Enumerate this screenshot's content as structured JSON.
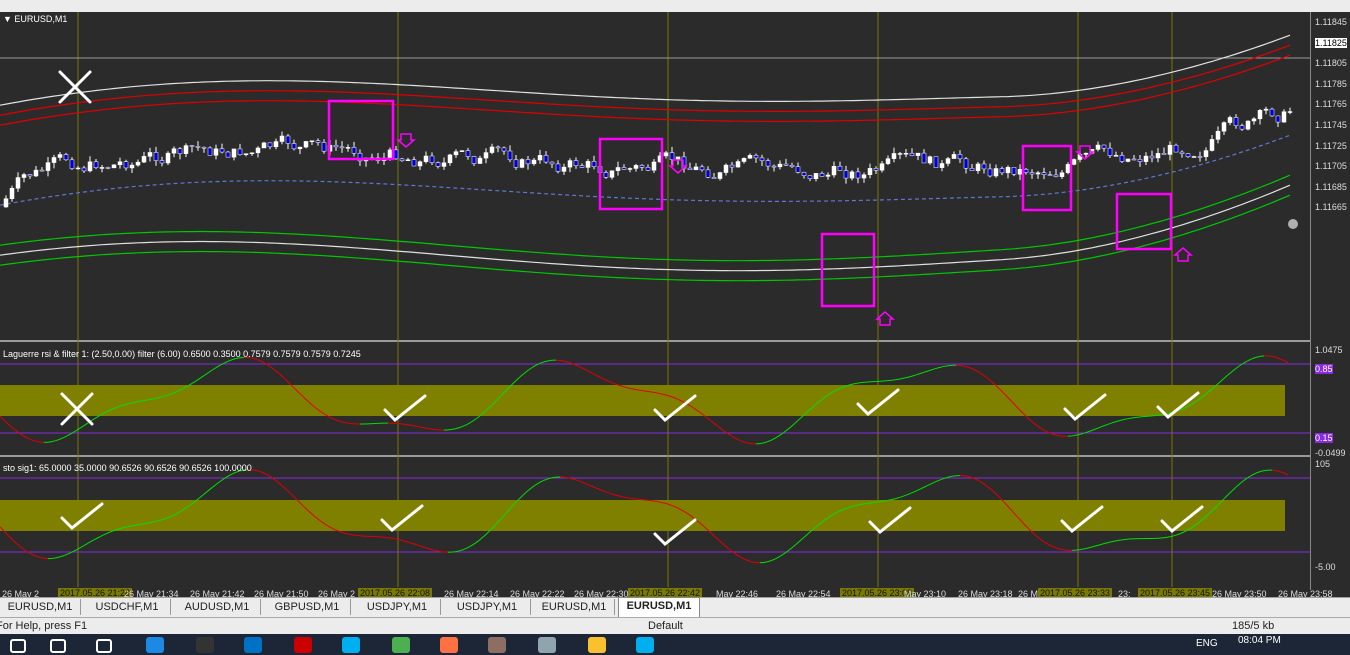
{
  "symbol_title": "EURUSD,M1",
  "price_axis": [
    "1.11845",
    "1.11825",
    "1.11805",
    "1.11785",
    "1.11765",
    "1.11745",
    "1.11725",
    "1.11705",
    "1.11685",
    "1.11665"
  ],
  "current_price": "1.11825",
  "laguerre": {
    "label": "Laguerre rsi & filter 1: (2.50,0.00) filter (6.00) 0.6500 0.3500 0.7579 0.7579 0.7579 0.7245",
    "axis": [
      "1.0475",
      "0.85",
      "0.15",
      "-0.0499"
    ]
  },
  "stochastic": {
    "label": "sto sig1: 65.0000 35.0000 90.6526 90.6526 90.6526 100.0000",
    "axis": [
      "105",
      "-5.00"
    ]
  },
  "time_axis": {
    "labels": [
      "26 May 2",
      "26 May 21:34",
      "26 May 21:42",
      "26 May 21:50",
      "26 May 2",
      "26 May 22:14",
      "26 May 22:22",
      "26 May 22:30",
      "May 22:46",
      "26 May 22:54",
      "May 23:10",
      "26 May 23:18",
      "26 M",
      "23:",
      "26 May 23:50",
      "26 May 23:58"
    ],
    "highlighted": [
      "2017.05.26 21:28",
      "2017.05.26 22:08",
      "2017.05.26 22:42",
      "2017.05.26 23:08",
      "2017.05.26 23:33",
      "2017.05.26 23:45"
    ]
  },
  "tabs": [
    "EURUSD,M1",
    "USDCHF,M1",
    "AUDUSD,M1",
    "GBPUSD,M1",
    "USDJPY,M1",
    "USDJPY,M1",
    "EURUSD,M1",
    "EURUSD,M1"
  ],
  "active_tab": 7,
  "status": {
    "help": "For Help, press F1",
    "profile": "Default",
    "traffic": "185/5 kb"
  },
  "taskbar": {
    "lang": "ENG",
    "time": "08:04 PM"
  },
  "colors": {
    "bull": "#ffffff",
    "bear": "#0000cc",
    "upper_band": "#e00000",
    "lower_band": "#00c800",
    "mid_band": "#e0e0e0",
    "box": "#ff00ff",
    "zone": "#808000",
    "vline": "#7a7a00"
  },
  "icons": [
    "start-icon",
    "search-icon",
    "task-view-icon",
    "edge-icon",
    "store-icon",
    "outlook-icon",
    "record-icon",
    "skype-icon",
    "chrome-icon",
    "firefox-icon",
    "mt4-icon",
    "notepad-icon",
    "explorer-icon",
    "skype2-icon"
  ]
}
